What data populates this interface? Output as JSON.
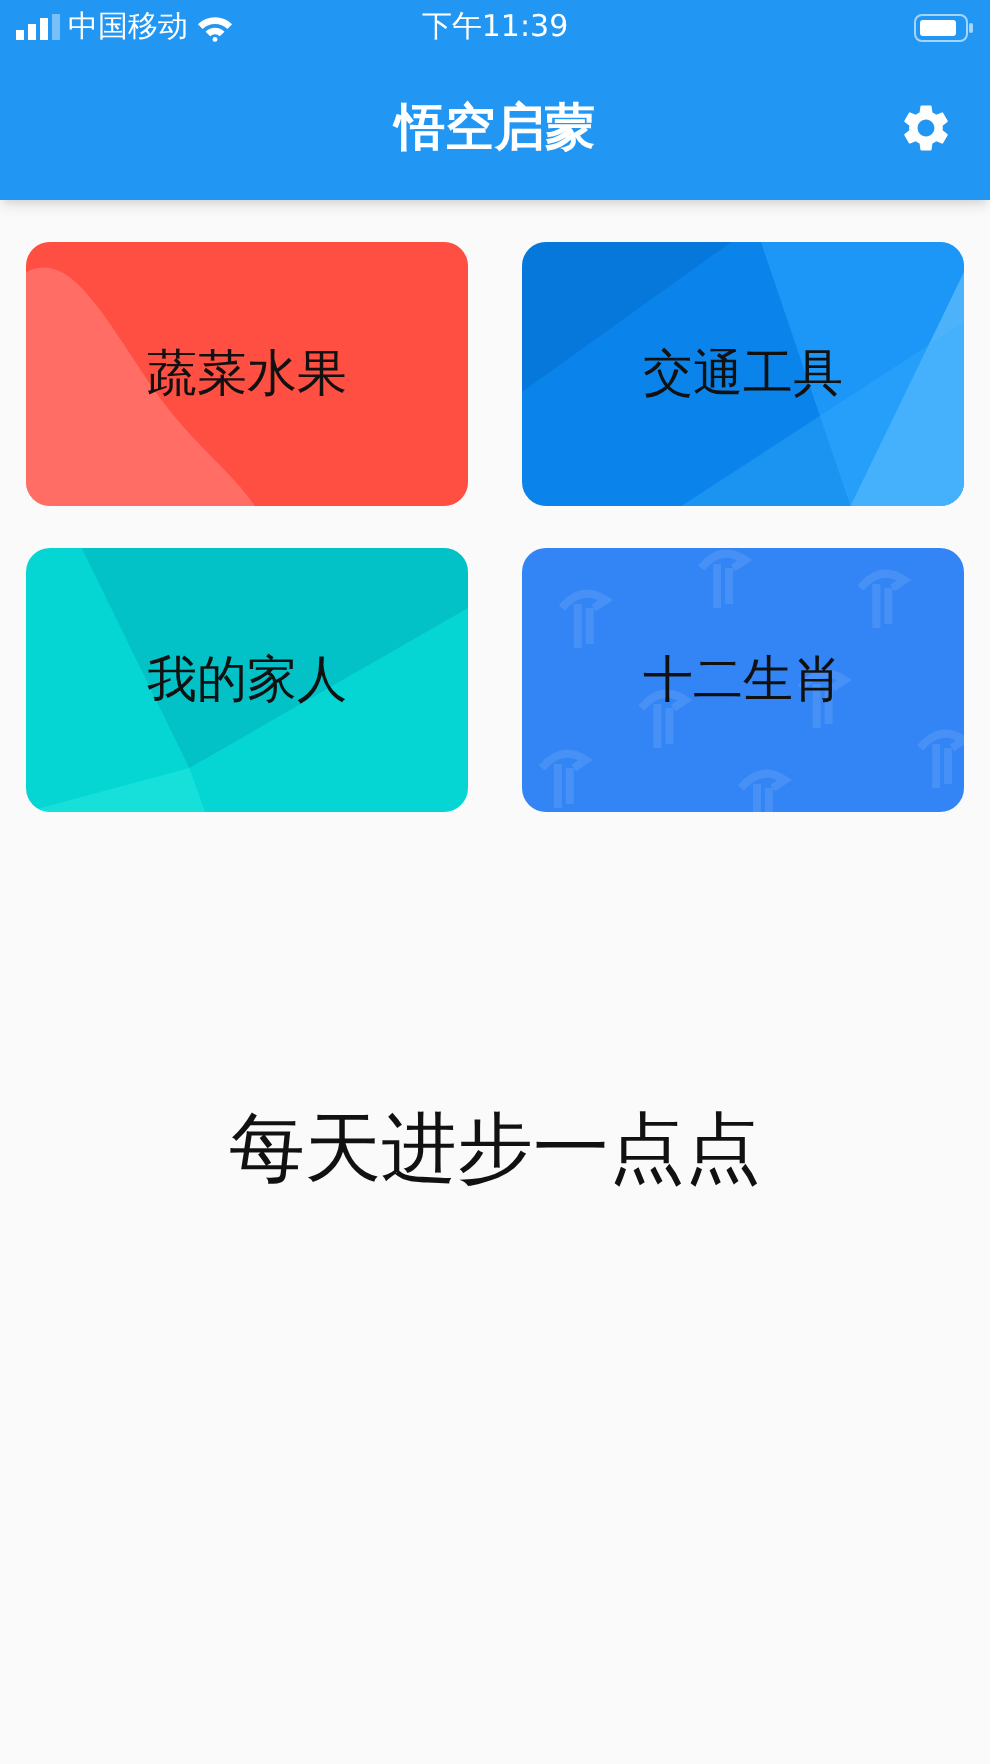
{
  "status_bar": {
    "carrier": "中国移动",
    "time": "下午11:39"
  },
  "app_bar": {
    "title": "悟空启蒙"
  },
  "cards": [
    {
      "label": "蔬菜水果",
      "kind": "wave",
      "color": "#ff5a4e"
    },
    {
      "label": "交通工具",
      "kind": "facets",
      "color": "#0a84ea"
    },
    {
      "label": "我的家人",
      "kind": "beams",
      "color": "#05d6d4"
    },
    {
      "label": "十二生肖",
      "kind": "pattern",
      "color": "#3385f5"
    }
  ],
  "slogan": "每天进步一点点"
}
